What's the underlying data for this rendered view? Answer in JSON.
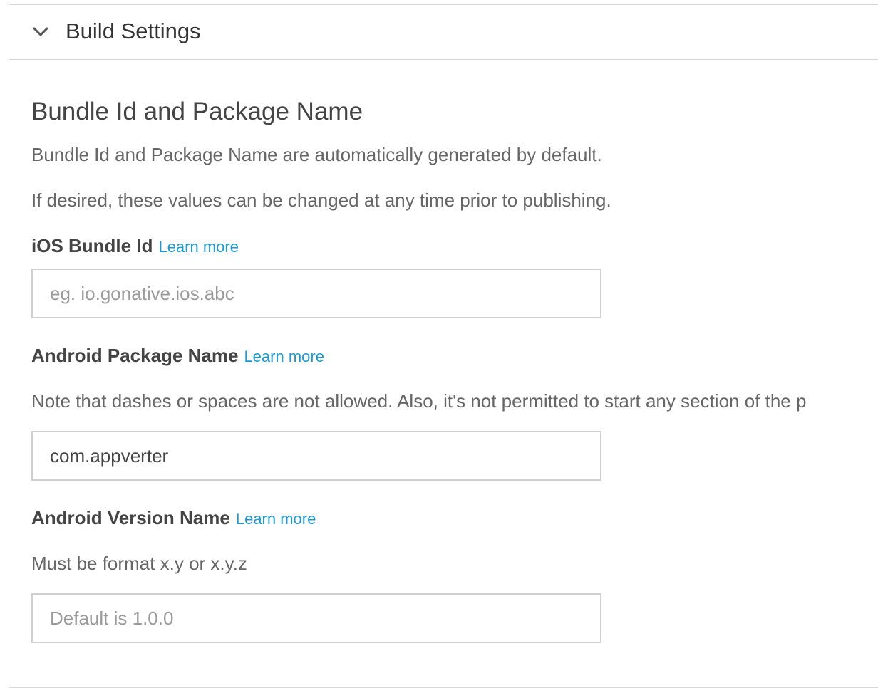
{
  "panel": {
    "title": "Build Settings"
  },
  "section": {
    "title": "Bundle Id and Package Name",
    "description_1": "Bundle Id and Package Name are automatically generated by default.",
    "description_2": "If desired, these values can be changed at any time prior to publishing."
  },
  "ios_bundle": {
    "label": "iOS Bundle Id",
    "learn_more": "Learn more",
    "value": "",
    "placeholder": "eg. io.gonative.ios.abc"
  },
  "android_package": {
    "label": "Android Package Name",
    "learn_more": "Learn more",
    "note": "Note that dashes or spaces are not allowed. Also, it's not permitted to start any section of the p",
    "value": "com.appverter",
    "placeholder": ""
  },
  "android_version": {
    "label": "Android Version Name",
    "learn_more": "Learn more",
    "note": "Must be format x.y or x.y.z",
    "value": "",
    "placeholder": "Default is 1.0.0"
  }
}
